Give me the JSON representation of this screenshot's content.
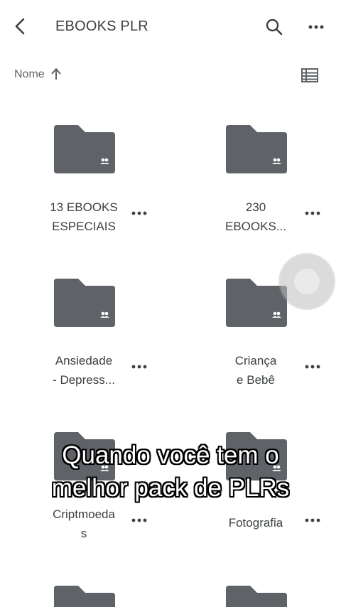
{
  "header": {
    "title": "EBOOKS PLR"
  },
  "sort": {
    "label": "Nome"
  },
  "folders": [
    {
      "name": "13 EBOOKS\nESPECIAIS"
    },
    {
      "name": "230\nEBOOKS..."
    },
    {
      "name": "Ansiedade\n- Depress..."
    },
    {
      "name": "Criança\ne Bebê"
    },
    {
      "name": "Criptmoeda\ns"
    },
    {
      "name": "Fotografia"
    }
  ],
  "caption": "Quando você tem o\nmelhor pack de PLRs",
  "colors": {
    "folder": "#5f6368",
    "text": "#3c4043",
    "background": "#ffffff"
  }
}
